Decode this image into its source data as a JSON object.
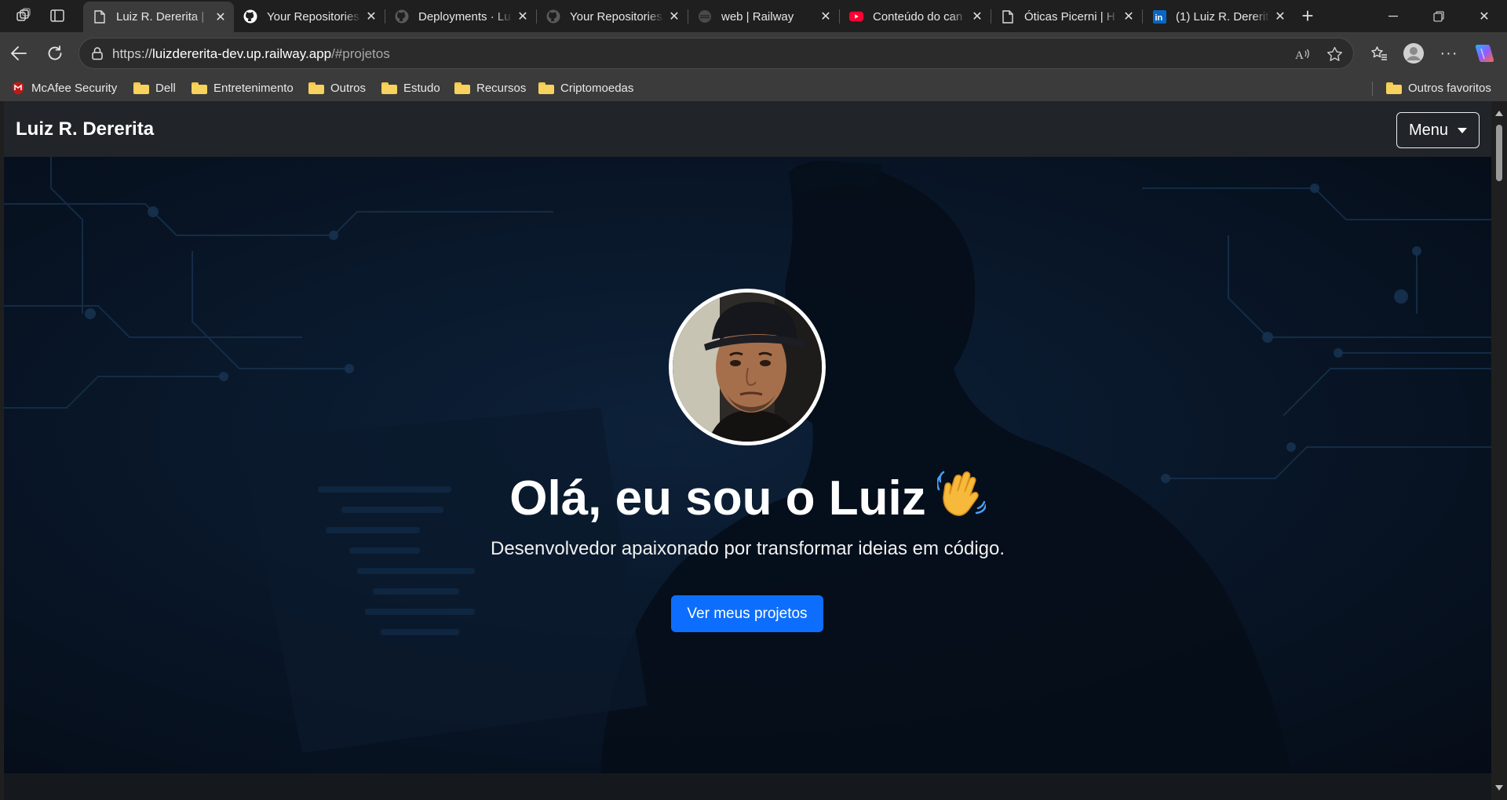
{
  "browser": {
    "tabs": [
      {
        "title": "Luiz R. Dererita | ",
        "icon": "page-icon",
        "active": true
      },
      {
        "title": "Your Repositories",
        "icon": "github-icon",
        "active": false
      },
      {
        "title": "Deployments · Lu",
        "icon": "github-icon",
        "active": false
      },
      {
        "title": "Your Repositories",
        "icon": "github-icon",
        "active": false
      },
      {
        "title": "web | Railway",
        "icon": "railway-icon",
        "active": false
      },
      {
        "title": "Conteúdo do can",
        "icon": "youtube-icon",
        "active": false
      },
      {
        "title": "Óticas Picerni | H",
        "icon": "page-icon",
        "active": false
      },
      {
        "title": "(1) Luiz R. Dererit",
        "icon": "linkedin-icon",
        "active": false
      }
    ],
    "address": {
      "scheme": "https://",
      "host": "luizdererita-dev.up.railway.app",
      "path": "/#projetos"
    },
    "bookmarks": [
      {
        "label": "McAfee Security",
        "icon": "mcafee-icon"
      },
      {
        "label": "Dell",
        "icon": "folder-icon"
      },
      {
        "label": "Entretenimento",
        "icon": "folder-icon"
      },
      {
        "label": "Outros",
        "icon": "folder-icon"
      },
      {
        "label": "Estudo",
        "icon": "folder-icon"
      },
      {
        "label": "Recursos",
        "icon": "folder-icon"
      },
      {
        "label": "Criptomoedas",
        "icon": "folder-icon"
      }
    ],
    "other_favorites": "Outros favoritos"
  },
  "page": {
    "brand": "Luiz R. Dererita",
    "menu_label": "Menu",
    "hero": {
      "title": "Olá, eu sou o Luiz",
      "emoji": "👋",
      "subtitle": "Desenvolvedor apaixonado por transformar ideias em código.",
      "cta": "Ver meus projetos"
    }
  },
  "colors": {
    "primary_button": "#0d6efd",
    "navbar": "#212529",
    "hero_background": "#081526"
  }
}
